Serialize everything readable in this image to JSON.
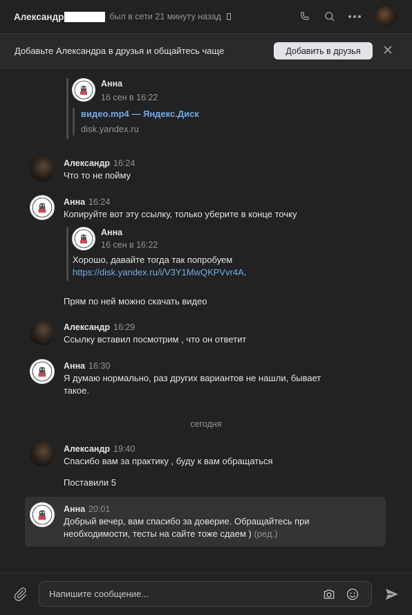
{
  "header": {
    "name": "Александр",
    "status": "был в сети 21 минуту назад"
  },
  "banner": {
    "text": "Добавьте Александра в друзья и общайтесь чаще",
    "button": "Добавить в друзья"
  },
  "messages": {
    "fwd1": {
      "name": "Анна",
      "date": "16 сен в 16:22",
      "link_title": "видео.mp4 — Яндекс.Диск",
      "link_domain": "disk.yandex.ru"
    },
    "m1": {
      "name": "Александр",
      "time": "16:24",
      "text": "Что то не пойму"
    },
    "m2": {
      "name": "Анна",
      "time": "16:24",
      "text": "Копируйте вот эту ссылку, только уберите в конце точку",
      "fwd": {
        "name": "Анна",
        "date": "16 сен в 16:22",
        "text": "Хорошо, давайте тогда так попробуем",
        "link": "https://disk.yandex.ru/i/V3Y1MwQKPVvr4A",
        "link_suffix": "."
      },
      "text2": "Прям по ней можно скачать видео"
    },
    "m3": {
      "name": "Александр",
      "time": "16:29",
      "text": "Ссылку вставил посмотрим , что он ответит"
    },
    "m4": {
      "name": "Анна",
      "time": "16:30",
      "line1": "Я думаю нормально, раз других вариантов не нашли, бывает",
      "line2": "такое."
    },
    "date_separator": "сегодня",
    "m5": {
      "name": "Александр",
      "time": "19:40",
      "text": "Спасибо вам за практику , буду к вам обращаться",
      "text2": "Поставили 5"
    },
    "m6": {
      "name": "Анна",
      "time": "20:01",
      "line1": "Добрый вечер, вам спасибо за доверие. Обращайтесь при",
      "line2": "необходимости, тесты на сайте тоже сдаем )",
      "edited": "(ред.)"
    }
  },
  "composer": {
    "placeholder": "Напишите сообщение..."
  },
  "icons": [
    "mobile-icon",
    "phone-icon",
    "search-icon",
    "more-icon",
    "close-icon",
    "paperclip-icon",
    "camera-icon",
    "emoji-icon",
    "send-icon"
  ]
}
